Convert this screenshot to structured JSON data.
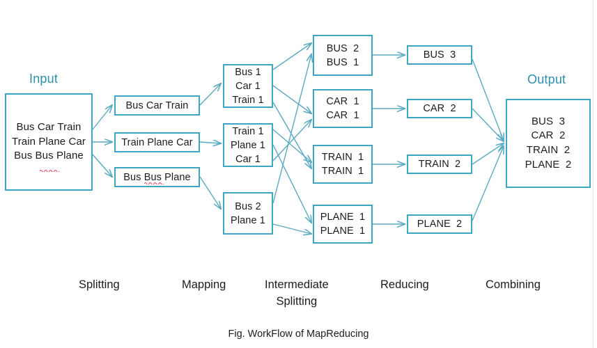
{
  "figure": {
    "caption": "Fig. WorkFlow of MapReducing",
    "accent_color": "#3ba7c4",
    "label_color": "#2e8fa8",
    "text_color": "#1c1c1c",
    "background": "#ffffff"
  },
  "sections": {
    "input_label": "Input",
    "output_label": "Output"
  },
  "input": {
    "lines": [
      "Bus Car Train",
      "Train Plane Car",
      "Bus Bus Plane"
    ]
  },
  "splitting": {
    "boxes": [
      {
        "lines": [
          "Bus Car Train"
        ]
      },
      {
        "lines": [
          "Train Plane Car"
        ]
      },
      {
        "lines": [
          "Bus Bus Plane"
        ]
      }
    ]
  },
  "mapping": {
    "boxes": [
      {
        "lines": [
          "Bus 1",
          "Car 1",
          "Train 1"
        ]
      },
      {
        "lines": [
          "Train 1",
          "Plane 1",
          "Car 1"
        ]
      },
      {
        "lines": [
          "Bus 2",
          "Plane 1"
        ]
      }
    ]
  },
  "intermediate_splitting": {
    "boxes": [
      {
        "lines": [
          "BUS  2",
          "BUS  1"
        ]
      },
      {
        "lines": [
          "CAR  1",
          "CAR  1"
        ]
      },
      {
        "lines": [
          "TRAIN  1",
          "TRAIN  1"
        ]
      },
      {
        "lines": [
          "PLANE  1",
          "PLANE  1"
        ]
      }
    ]
  },
  "reducing": {
    "boxes": [
      {
        "lines": [
          "BUS  3"
        ]
      },
      {
        "lines": [
          "CAR  2"
        ]
      },
      {
        "lines": [
          "TRAIN  2"
        ]
      },
      {
        "lines": [
          "PLANE  2"
        ]
      }
    ]
  },
  "output": {
    "lines": [
      "BUS  3",
      "CAR  2",
      "TRAIN  2",
      "PLANE  2"
    ]
  },
  "stage_labels": [
    {
      "text": "Splitting",
      "text2": ""
    },
    {
      "text": "Mapping",
      "text2": ""
    },
    {
      "text": "Intermediate",
      "text2": "Splitting"
    },
    {
      "text": "Reducing",
      "text2": ""
    },
    {
      "text": "Combining",
      "text2": ""
    }
  ]
}
